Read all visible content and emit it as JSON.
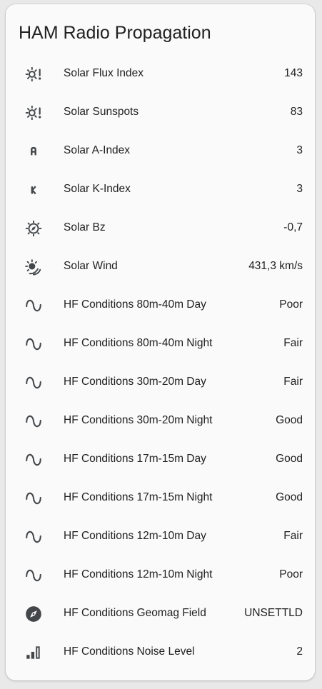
{
  "card": {
    "title": "HAM Radio Propagation"
  },
  "colors": {
    "icon": "#44474a",
    "text": "#212121",
    "card_bg": "#fafafa"
  },
  "rows": [
    {
      "icon": "sun-alert-icon",
      "label": "Solar Flux Index",
      "value": "143"
    },
    {
      "icon": "sun-alert-icon",
      "label": "Solar Sunspots",
      "value": "83"
    },
    {
      "icon": "letter-a-icon",
      "label": "Solar A-Index",
      "value": "3"
    },
    {
      "icon": "letter-k-icon",
      "label": "Solar K-Index",
      "value": "3"
    },
    {
      "icon": "sun-compass-icon",
      "label": "Solar Bz",
      "value": "-0,7"
    },
    {
      "icon": "sun-wind-icon",
      "label": "Solar Wind",
      "value": "431,3 km/s"
    },
    {
      "icon": "sine-wave-icon",
      "label": "HF Conditions 80m-40m Day",
      "value": "Poor"
    },
    {
      "icon": "sine-wave-icon",
      "label": "HF Conditions 80m-40m Night",
      "value": "Fair"
    },
    {
      "icon": "sine-wave-icon",
      "label": "HF Conditions 30m-20m Day",
      "value": "Fair"
    },
    {
      "icon": "sine-wave-icon",
      "label": "HF Conditions 30m-20m Night",
      "value": "Good"
    },
    {
      "icon": "sine-wave-icon",
      "label": "HF Conditions 17m-15m Day",
      "value": "Good"
    },
    {
      "icon": "sine-wave-icon",
      "label": "HF Conditions 17m-15m Night",
      "value": "Good"
    },
    {
      "icon": "sine-wave-icon",
      "label": "HF Conditions 12m-10m Day",
      "value": "Fair"
    },
    {
      "icon": "sine-wave-icon",
      "label": "HF Conditions 12m-10m Night",
      "value": "Poor"
    },
    {
      "icon": "compass-icon",
      "label": "HF Conditions Geomag Field",
      "value": "UNSETTLD"
    },
    {
      "icon": "signal-bars-icon",
      "label": "HF Conditions Noise Level",
      "value": "2"
    }
  ]
}
